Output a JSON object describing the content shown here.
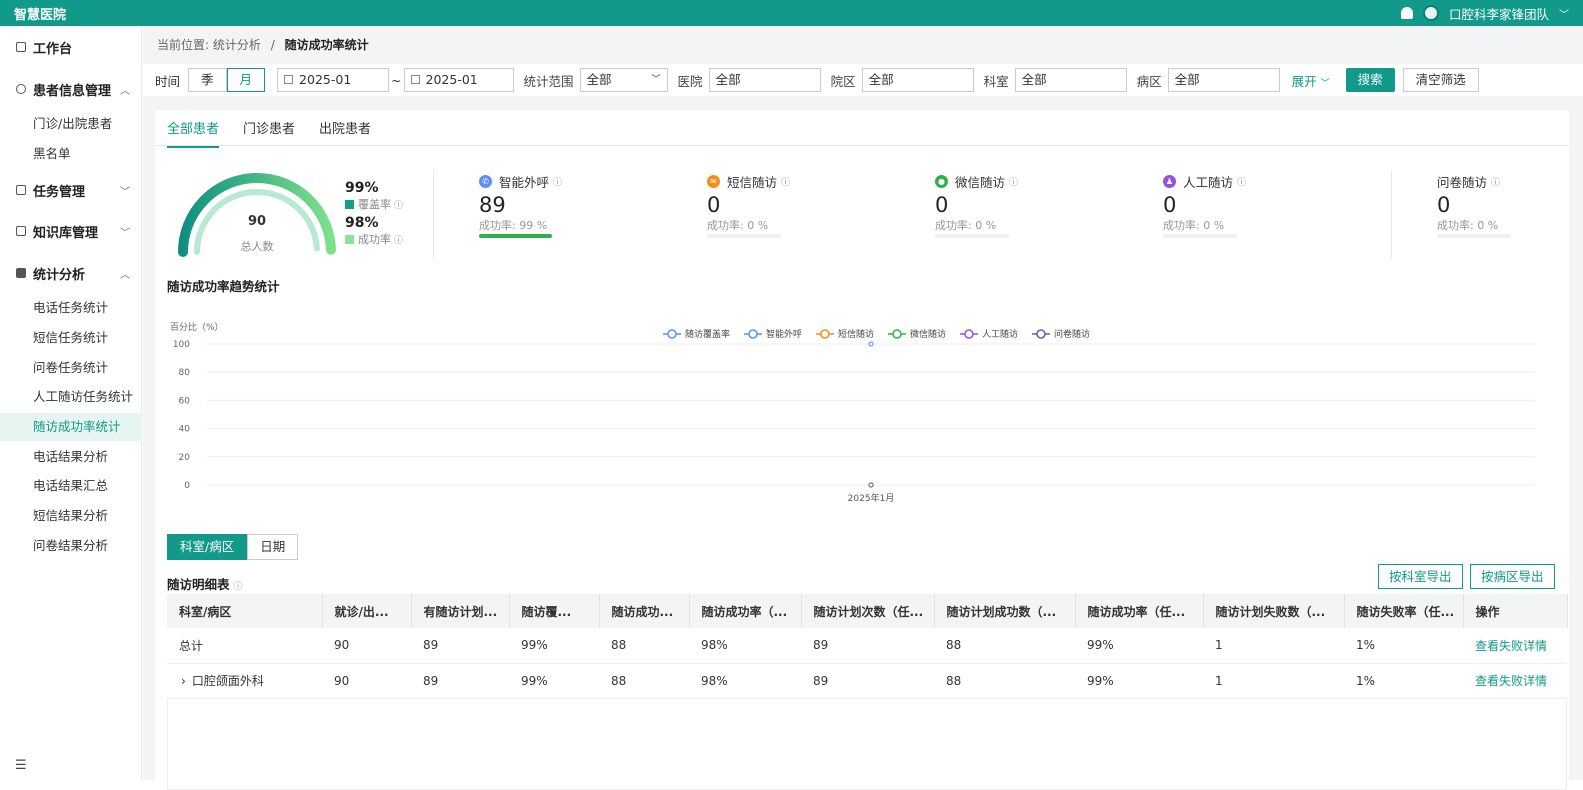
{
  "app": {
    "title": "智慧医院",
    "user": "口腔科李家锋团队"
  },
  "sidebar": {
    "workbench": "工作台",
    "groups": [
      {
        "label": "患者信息管理",
        "items": [
          "门诊/出院患者",
          "黑名单"
        ]
      },
      {
        "label": "任务管理"
      },
      {
        "label": "知识库管理"
      },
      {
        "label": "统计分析",
        "items": [
          "电话任务统计",
          "短信任务统计",
          "问卷任务统计",
          "人工随访任务统计",
          "随访成功率统计",
          "电话结果分析",
          "电话结果汇总",
          "短信结果分析",
          "问卷结果分析"
        ]
      }
    ],
    "active": "随访成功率统计"
  },
  "breadcrumb": {
    "prefix": "当前位置:",
    "parent": "统计分析",
    "sep": "/",
    "current": "随访成功率统计"
  },
  "filters": {
    "time_label": "时间",
    "time_options": [
      "季",
      "月"
    ],
    "time_selected": "月",
    "date_from": "2025-01",
    "date_sep": "~",
    "date_to": "2025-01",
    "range_label": "统计范围",
    "range_value": "全部",
    "hospital_label": "医院",
    "hospital_value": "全部",
    "campus_label": "院区",
    "campus_value": "全部",
    "dept_label": "科室",
    "dept_value": "全部",
    "ward_label": "病区",
    "ward_value": "全部",
    "expand": "展开",
    "search": "搜索",
    "clear": "清空筛选"
  },
  "tabs": [
    "全部患者",
    "门诊患者",
    "出院患者"
  ],
  "summary": {
    "total": "90",
    "total_label": "总人数",
    "coverage": "99%",
    "coverage_label": "覆盖率",
    "success": "98%",
    "success_label": "成功率",
    "coverage_fraction": 0.99,
    "success_fraction": 0.98
  },
  "metrics": [
    {
      "name": "智能外呼",
      "value": "89",
      "rate_text": "成功率: 99 %",
      "rate": 0.99,
      "color": "#5b8ff9"
    },
    {
      "name": "短信随访",
      "value": "0",
      "rate_text": "成功率: 0 %",
      "rate": 0,
      "color": "#fa8c16"
    },
    {
      "name": "微信随访",
      "value": "0",
      "rate_text": "成功率: 0 %",
      "rate": 0,
      "color": "#2bb24c"
    },
    {
      "name": "人工随访",
      "value": "0",
      "rate_text": "成功率: 0 %",
      "rate": 0,
      "color": "#9254de"
    },
    {
      "name": "问卷随访",
      "value": "0",
      "rate_text": "成功率: 0 %",
      "rate": 0,
      "color": "#5b5ea6"
    }
  ],
  "chart_data": {
    "type": "line",
    "title": "随访成功率趋势统计",
    "ylabel": "百分比（%）",
    "ylim": [
      0,
      100
    ],
    "yticks": [
      0,
      20,
      40,
      60,
      80,
      100
    ],
    "categories": [
      "2025年1月"
    ],
    "series": [
      {
        "name": "随访覆盖率",
        "values": [
          100
        ],
        "color": "#5b8ff9"
      },
      {
        "name": "智能外呼",
        "values": [
          100
        ],
        "color": "#5b8ff9"
      },
      {
        "name": "短信随访",
        "values": [
          0
        ],
        "color": "#fa8c16"
      },
      {
        "name": "微信随访",
        "values": [
          0
        ],
        "color": "#2bb24c"
      },
      {
        "name": "人工随访",
        "values": [
          0
        ],
        "color": "#9254de"
      },
      {
        "name": "问卷随访",
        "values": [
          0
        ],
        "color": "#5b5ea6"
      }
    ],
    "legend": "top-center",
    "grid": true
  },
  "detail": {
    "view_options": [
      "科室/病区",
      "日期"
    ],
    "view_selected": "科室/病区",
    "title": "随访明细表",
    "export_dept": "按科室导出",
    "export_ward": "按病区导出",
    "columns": [
      "科室/病区",
      "就诊/出...",
      "有随访计划...",
      "随访覆...",
      "随访成功...",
      "随访成功率（...",
      "随访计划次数（任...",
      "随访计划成功数（...",
      "随访成功率（任...",
      "随访计划失败数（...",
      "随访失败率（任...",
      "操作"
    ],
    "rows": [
      {
        "name": "总计",
        "cells": [
          "90",
          "89",
          "99%",
          "88",
          "98%",
          "89",
          "88",
          "99%",
          "1",
          "1%"
        ],
        "action": "查看失败详情"
      },
      {
        "name": "口腔颌面外科",
        "cells": [
          "90",
          "89",
          "99%",
          "88",
          "98%",
          "89",
          "88",
          "99%",
          "1",
          "1%"
        ],
        "action": "查看失败详情"
      }
    ]
  }
}
